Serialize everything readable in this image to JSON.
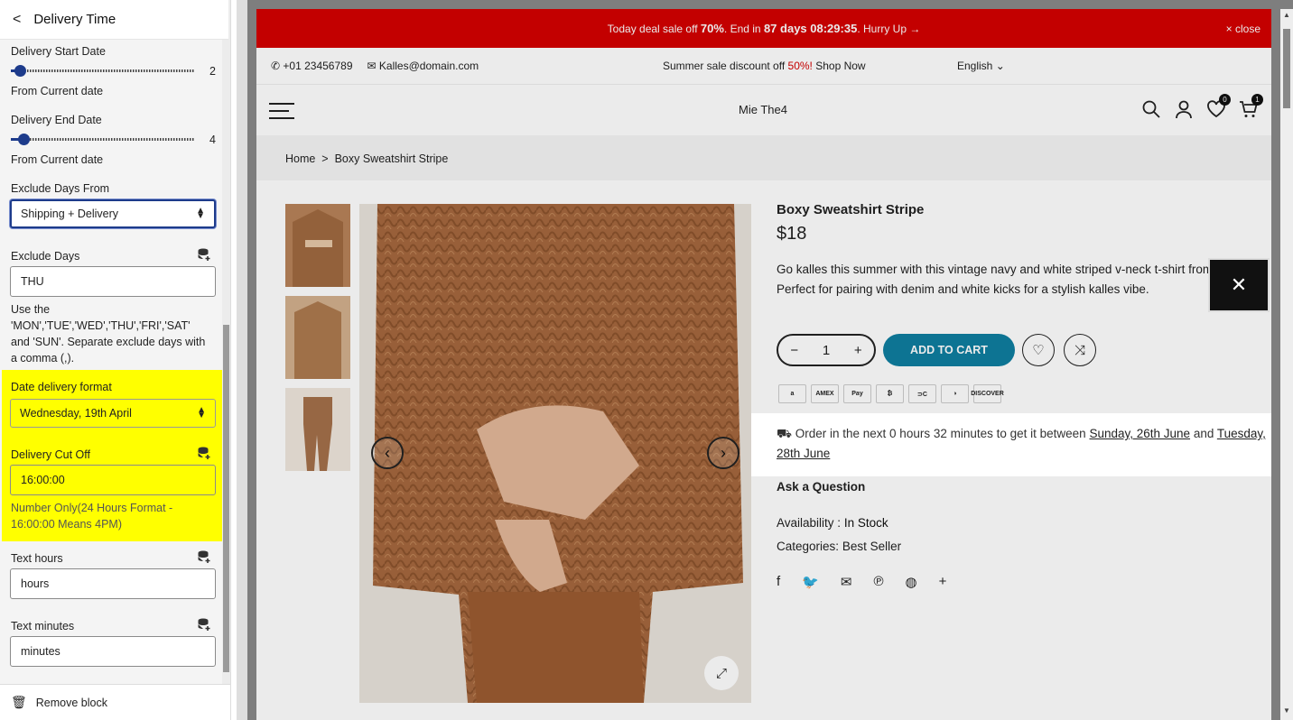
{
  "panel": {
    "title": "Delivery Time",
    "start_label": "Delivery Start Date",
    "start_value": "2",
    "start_fraction": 0.05,
    "start_help": "From Current date",
    "end_label": "Delivery End Date",
    "end_value": "4",
    "end_fraction": 0.07,
    "end_help": "From Current date",
    "exclude_from_label": "Exclude Days From",
    "exclude_from_value": "Shipping + Delivery",
    "exclude_days_label": "Exclude Days",
    "exclude_days_value": "THU",
    "exclude_days_help": "Use the 'MON','TUE','WED','THU','FRI','SAT' and 'SUN'. Separate exclude days with a comma (,).",
    "format_label": "Date delivery format",
    "format_value": "Wednesday, 19th April",
    "cutoff_label": "Delivery Cut Off",
    "cutoff_value": "16:00:00",
    "cutoff_help": "Number Only(24 Hours Format - 16:00:00 Means 4PM)",
    "hours_label": "Text hours",
    "hours_value": "hours",
    "minutes_label": "Text minutes",
    "minutes_value": "minutes",
    "remove_label": "Remove block"
  },
  "store": {
    "announce_pre": "Today deal sale off",
    "announce_pct": "70%",
    "announce_mid": ". End in",
    "announce_time": "87 days 08:29:35",
    "announce_post": ". Hurry Up →",
    "close": "× close",
    "phone": "+01 23456789",
    "email": "Kalles@domain.com",
    "promo_pre": "Summer sale discount off",
    "promo_pct": "50%!",
    "promo_link": "Shop Now",
    "language": "English ⌄",
    "logo": "Mie The4",
    "wishlist_count": "0",
    "cart_count": "1",
    "breadcrumb_home": "Home",
    "breadcrumb_sep": ">",
    "breadcrumb_current": "Boxy Sweatshirt Stripe"
  },
  "product": {
    "name": "Boxy Sweatshirt Stripe",
    "price": "$18",
    "description": "Go kalles this summer with this vintage navy and white striped v-neck t-shirt from the Nike. Perfect for pairing with denim and white kicks for a stylish kalles vibe.",
    "qty": "1",
    "add_to_cart": "ADD TO CART",
    "payments": [
      "a",
      "AMEX",
      "Pay",
      "₿",
      "⊃C",
      "◑",
      "DISCOVER"
    ],
    "delivery_pre": "Order in the next 0 hours 32 minutes to get it between",
    "delivery_start": "Sunday, 26th June",
    "delivery_and": "and",
    "delivery_end": "Tuesday, 28th June",
    "ask": "Ask a Question",
    "availability_label": "Availability :",
    "availability_value": "In Stock",
    "categories_label": "Categories:",
    "categories_value": "Best Seller"
  },
  "colors": {
    "accent": "#1d3b8b",
    "highlight": "#ffff00",
    "announce_bg": "#d40000",
    "cart_button": "#0f7ea0"
  }
}
